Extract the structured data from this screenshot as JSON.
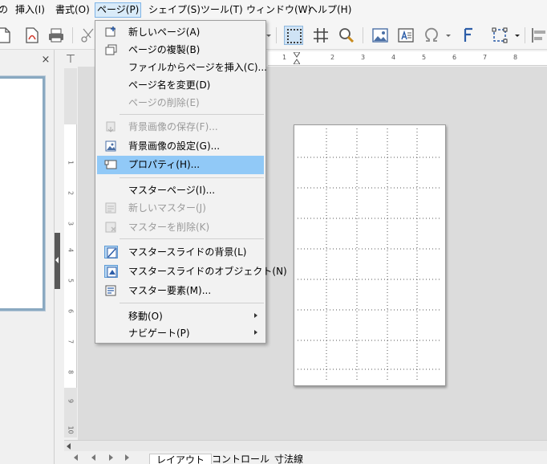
{
  "menubar": {
    "items": [
      {
        "label": "の",
        "name": "menu-partial"
      },
      {
        "label": "挿入(I)",
        "name": "menu-insert"
      },
      {
        "label": "書式(O)",
        "name": "menu-format"
      },
      {
        "label": "ページ(P)",
        "name": "menu-page"
      },
      {
        "label": "シェイプ(S)",
        "name": "menu-shape"
      },
      {
        "label": "ツール(T)",
        "name": "menu-tools"
      },
      {
        "label": "ウィンドウ(W)",
        "name": "menu-window"
      },
      {
        "label": "ヘルプ(H)",
        "name": "menu-help"
      }
    ],
    "active_index": 3
  },
  "page_menu": {
    "items": [
      {
        "label": "新しいページ(A)",
        "icon": "new-page-icon",
        "disabled": false
      },
      {
        "label": "ページの複製(B)",
        "icon": "duplicate-page-icon",
        "disabled": false
      },
      {
        "label": "ファイルからページを挿入(C)...",
        "icon": "",
        "disabled": false
      },
      {
        "label": "ページ名を変更(D)",
        "icon": "",
        "disabled": false
      },
      {
        "label": "ページの削除(E)",
        "icon": "",
        "disabled": true
      },
      {
        "label": "背景画像の保存(F)...",
        "icon": "save-background-icon",
        "disabled": true
      },
      {
        "label": "背景画像の設定(G)...",
        "icon": "set-background-icon",
        "disabled": false
      },
      {
        "label": "プロパティ(H)...",
        "icon": "page-properties-icon",
        "disabled": false,
        "highlighted": true
      },
      {
        "label": "マスターページ(I)...",
        "icon": "",
        "disabled": false
      },
      {
        "label": "新しいマスター(J)",
        "icon": "new-master-icon",
        "disabled": true
      },
      {
        "label": "マスターを削除(K)",
        "icon": "delete-master-icon",
        "disabled": true
      },
      {
        "label": "マスタースライドの背景(L)",
        "icon": "master-background-icon",
        "disabled": false,
        "checked": true
      },
      {
        "label": "マスタースライドのオブジェクト(N)",
        "icon": "master-objects-icon",
        "disabled": false,
        "checked": true
      },
      {
        "label": "マスター要素(M)...",
        "icon": "master-elements-icon",
        "disabled": false
      },
      {
        "label": "移動(O)",
        "icon": "",
        "disabled": false,
        "submenu": true
      },
      {
        "label": "ナビゲート(P)",
        "icon": "",
        "disabled": false,
        "submenu": true
      }
    ]
  },
  "hruler": {
    "labels": [
      "1",
      "2",
      "3",
      "4",
      "5",
      "6",
      "7",
      "8"
    ]
  },
  "vruler": {
    "labels": [
      "1",
      "2",
      "3",
      "4",
      "5",
      "6",
      "7",
      "8",
      "9",
      "10"
    ]
  },
  "slide_pane": {
    "close_glyph": "×"
  },
  "ruler_corner_glyph": "⊤",
  "bottom_tabs": {
    "tabs": [
      {
        "label": "レイアウト",
        "active": true
      },
      {
        "label": "コントロール",
        "active": false
      },
      {
        "label": "寸法線",
        "active": false
      }
    ]
  },
  "colors": {
    "menu_highlight": "#91c9f7",
    "active_menu": "#d9ebf9",
    "canvas": "#dcdcdc",
    "thumb_border": "#8aa9c1"
  }
}
